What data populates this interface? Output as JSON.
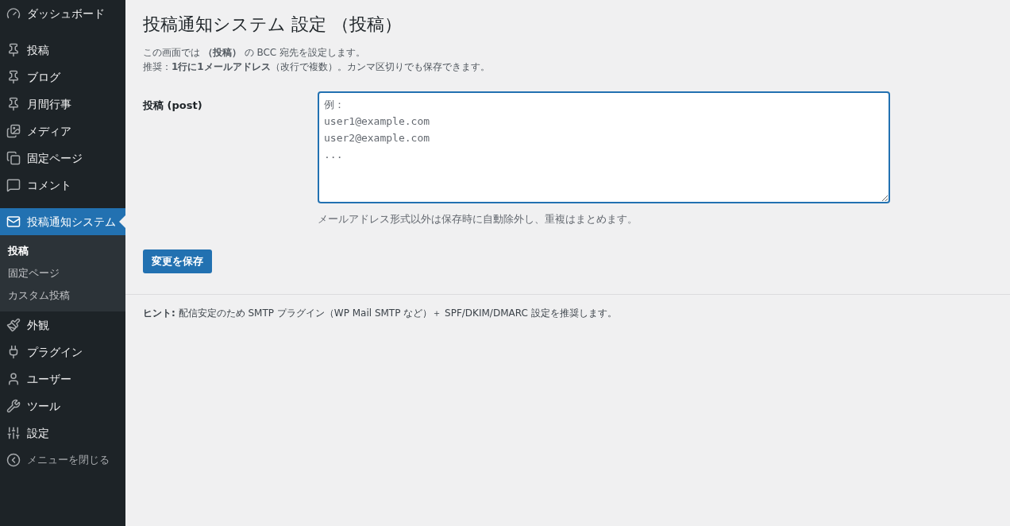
{
  "sidebar": {
    "groups": [
      {
        "items": [
          {
            "label": "ダッシュボード",
            "selected": false
          }
        ]
      },
      {
        "items": [
          {
            "label": "投稿",
            "selected": false
          },
          {
            "label": "ブログ",
            "selected": false
          },
          {
            "label": "月間行事",
            "selected": false
          },
          {
            "label": "メディア",
            "selected": false
          },
          {
            "label": "固定ページ",
            "selected": false
          },
          {
            "label": "コメント",
            "selected": false
          }
        ]
      },
      {
        "items": [
          {
            "label": "投稿通知システム",
            "selected": true,
            "children": [
              {
                "label": "投稿",
                "selected": true
              },
              {
                "label": "固定ページ",
                "selected": false
              },
              {
                "label": "カスタム投稿",
                "selected": false
              }
            ]
          },
          {
            "label": "外観",
            "selected": false
          },
          {
            "label": "プラグイン",
            "selected": false
          },
          {
            "label": "ユーザー",
            "selected": false
          },
          {
            "label": "ツール",
            "selected": false
          },
          {
            "label": "設定",
            "selected": false
          }
        ]
      }
    ],
    "collapse": "メニューを閉じる"
  },
  "page": {
    "title": "投稿通知システム 設定 （投稿）",
    "description": [
      "この画面では **（投稿）** の BCC 宛先を設定します。",
      "推奨：**1行に1メールアドレス**（改行で複数）。カンマ区切りでも保存できます。"
    ],
    "field": {
      "label": "投稿 (post)",
      "placeholder": "例：\nuser1@example.com\nuser2@example.com\n...",
      "help": "メールアドレス形式以外は保存時に自動除外し、重複はまとめます。"
    },
    "save_button": "変更を保存",
    "hint": "**ヒント:** 配信安定のため SMTP プラグイン（WP Mail SMTP など）＋ SPF/DKIM/DMARC 設定を推奨します。"
  }
}
